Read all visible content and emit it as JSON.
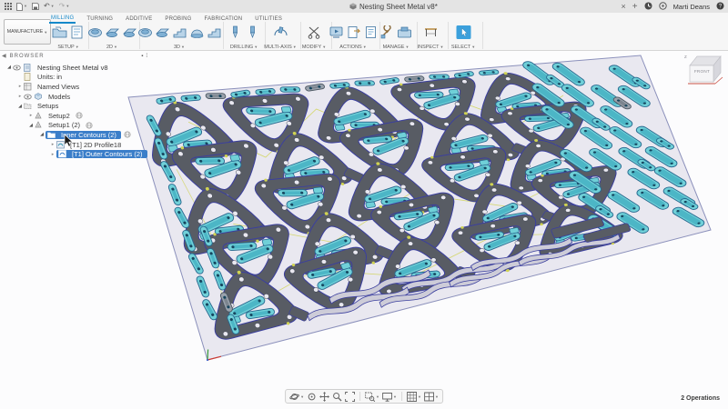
{
  "titlebar": {
    "document_tab": {
      "title": "Nesting Sheet Metal v8*"
    },
    "close_tab": "×",
    "new_tab": "+",
    "user_name": "Marti Deans",
    "help": "?"
  },
  "ribbon": {
    "workspace_label": "MANUFACTURE",
    "tabs": [
      {
        "label": "MILLING",
        "active": true
      },
      {
        "label": "TURNING",
        "active": false
      },
      {
        "label": "ADDITIVE",
        "active": false
      },
      {
        "label": "PROBING",
        "active": false
      },
      {
        "label": "FABRICATION",
        "active": false
      },
      {
        "label": "UTILITIES",
        "active": false
      }
    ],
    "groups": [
      {
        "label": "SETUP",
        "icons": [
          "setup-folder",
          "gcode"
        ]
      },
      {
        "label": "2D",
        "icons": [
          "contour2d",
          "pocket2d",
          "face"
        ]
      },
      {
        "label": "3D",
        "icons": [
          "adaptive",
          "pocket3d",
          "parallel",
          "scallop",
          "ramp"
        ]
      },
      {
        "label": "DRILLING",
        "icons": [
          "drill",
          "bore"
        ]
      },
      {
        "label": "MULTI-AXIS",
        "icons": [
          "multiaxis"
        ]
      },
      {
        "label": "MODIFY",
        "icons": [
          "trim"
        ]
      },
      {
        "label": "ACTIONS",
        "icons": [
          "simulate",
          "post-process",
          "setup-sheet"
        ]
      },
      {
        "label": "MANAGE",
        "icons": [
          "tool-library",
          "machine-library"
        ]
      },
      {
        "label": "INSPECT",
        "icons": [
          "measure"
        ]
      },
      {
        "label": "SELECT",
        "icons": [
          "select"
        ],
        "active": true
      }
    ]
  },
  "browser": {
    "header": "BROWSER",
    "tree": [
      {
        "label": "Nesting Sheet Metal v8",
        "depth": 0,
        "arrow": "expanded",
        "eye": true,
        "icon": "document",
        "selected": false,
        "wcs": false
      },
      {
        "label": "Units: in",
        "depth": 1,
        "arrow": "none",
        "eye": false,
        "icon": "units",
        "selected": false,
        "wcs": false
      },
      {
        "label": "Named Views",
        "depth": 1,
        "arrow": "collapsed",
        "eye": false,
        "icon": "views",
        "selected": false,
        "wcs": false
      },
      {
        "label": "Models",
        "depth": 1,
        "arrow": "collapsed",
        "eye": true,
        "icon": "models",
        "selected": false,
        "wcs": false
      },
      {
        "label": "Setups",
        "depth": 1,
        "arrow": "expanded",
        "eye": false,
        "icon": "setups-folder",
        "selected": false,
        "wcs": false
      },
      {
        "label": "Setup2",
        "depth": 2,
        "arrow": "collapsed",
        "eye": false,
        "icon": "setup",
        "selected": false,
        "wcs": true
      },
      {
        "label": "Setup1 (2)",
        "depth": 2,
        "arrow": "expanded",
        "eye": false,
        "icon": "setup",
        "selected": false,
        "wcs": true
      },
      {
        "label": "Inner Contours (2)",
        "depth": 3,
        "arrow": "expanded",
        "eye": false,
        "icon": "folder",
        "selected": true,
        "wcs": true
      },
      {
        "label": "[T1] 2D Profile18",
        "depth": 4,
        "arrow": "collapsed",
        "eye": false,
        "icon": "operation",
        "selected": false,
        "wcs": false
      },
      {
        "label": "[T1] Outer Contours (2)",
        "depth": 4,
        "arrow": "collapsed",
        "eye": false,
        "icon": "operation",
        "selected": true,
        "wcs": false
      }
    ]
  },
  "viewport": {
    "view_cube": {
      "front_label": "FRONT"
    },
    "operations_label": "2 Operations",
    "colors": {
      "background": "#fcfcfd",
      "sheet": "#e9e8f0",
      "sheet_edge": "#8b90bb",
      "part": "#585c64",
      "contour": "#3b3f9e",
      "selected": "#70d0d8",
      "selected_dark": "#4cb6c6",
      "selected_stroke": "#27688f",
      "link": "#d0d352",
      "bracket": "#cdccd8",
      "axis_x": "#cc3b34",
      "axis_y": "#3a9b3a",
      "axis_z": "#3a62c9"
    },
    "nesting": {
      "triangle_cols": 5,
      "triangle_rows": 5,
      "right_capsule_cols": 4,
      "right_capsule_rows": 8
    }
  },
  "navbar": {
    "items": [
      {
        "icon": "orbit",
        "dropdown": true
      },
      {
        "icon": "look-at",
        "dropdown": false
      },
      {
        "icon": "pan",
        "dropdown": false
      },
      {
        "icon": "zoom",
        "dropdown": false
      },
      {
        "icon": "fit",
        "dropdown": false
      },
      {
        "icon": "zoom-window",
        "dropdown": true
      },
      {
        "icon": "display-settings",
        "dropdown": true
      },
      {
        "icon": "grid-settings",
        "dropdown": true
      },
      {
        "icon": "viewports",
        "dropdown": true
      }
    ]
  }
}
